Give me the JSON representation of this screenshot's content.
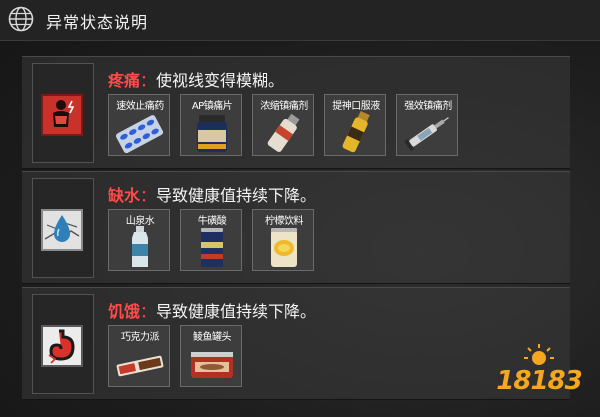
{
  "header": {
    "title": "异常状态说明",
    "icon": "globe-icon"
  },
  "conditions": [
    {
      "name": "疼痛",
      "colon": "：",
      "description": "使视线变得模糊。",
      "icon": "pain-icon",
      "items": [
        {
          "label": "速效止痛药",
          "icon": "pill-blister-icon"
        },
        {
          "label": "AP镇痛片",
          "icon": "pill-bottle-icon"
        },
        {
          "label": "浓缩镇痛剂",
          "icon": "spray-bottle-icon"
        },
        {
          "label": "提神口服液",
          "icon": "vial-icon"
        },
        {
          "label": "强效镇痛剂",
          "icon": "syringe-icon"
        }
      ]
    },
    {
      "name": "缺水",
      "colon": "：",
      "description": "导致健康值持续下降。",
      "icon": "dehydration-icon",
      "items": [
        {
          "label": "山泉水",
          "icon": "water-bottle-icon"
        },
        {
          "label": "牛磺酸",
          "icon": "energy-can-icon"
        },
        {
          "label": "柠檬饮料",
          "icon": "lemon-can-icon"
        }
      ]
    },
    {
      "name": "饥饿",
      "colon": "：",
      "description": "导致健康值持续下降。",
      "icon": "hunger-icon",
      "items": [
        {
          "label": "巧克力派",
          "icon": "chocolate-bar-icon"
        },
        {
          "label": "鲮鱼罐头",
          "icon": "fish-can-icon"
        }
      ]
    }
  ],
  "watermark": {
    "text": "18183",
    "color": "#f5a71f"
  }
}
